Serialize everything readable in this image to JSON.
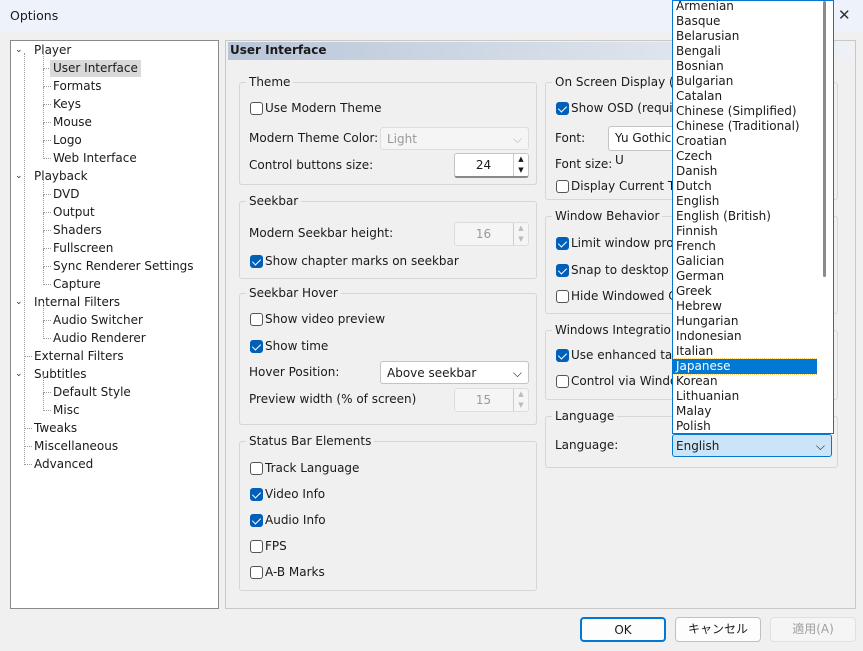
{
  "window": {
    "title": "Options"
  },
  "tree": [
    {
      "label": "Player",
      "level": 0,
      "expanded": true
    },
    {
      "label": "User Interface",
      "level": 1,
      "selected": true
    },
    {
      "label": "Formats",
      "level": 1
    },
    {
      "label": "Keys",
      "level": 1
    },
    {
      "label": "Mouse",
      "level": 1
    },
    {
      "label": "Logo",
      "level": 1
    },
    {
      "label": "Web Interface",
      "level": 1
    },
    {
      "label": "Playback",
      "level": 0,
      "expanded": true
    },
    {
      "label": "DVD",
      "level": 1
    },
    {
      "label": "Output",
      "level": 1
    },
    {
      "label": "Shaders",
      "level": 1
    },
    {
      "label": "Fullscreen",
      "level": 1
    },
    {
      "label": "Sync Renderer Settings",
      "level": 1
    },
    {
      "label": "Capture",
      "level": 1
    },
    {
      "label": "Internal Filters",
      "level": 0,
      "expanded": true
    },
    {
      "label": "Audio Switcher",
      "level": 1
    },
    {
      "label": "Audio Renderer",
      "level": 1
    },
    {
      "label": "External Filters",
      "level": 0
    },
    {
      "label": "Subtitles",
      "level": 0,
      "expanded": true
    },
    {
      "label": "Default Style",
      "level": 1
    },
    {
      "label": "Misc",
      "level": 1
    },
    {
      "label": "Tweaks",
      "level": 0
    },
    {
      "label": "Miscellaneous",
      "level": 0
    },
    {
      "label": "Advanced",
      "level": 0
    }
  ],
  "page_title": "User Interface",
  "theme": {
    "title": "Theme",
    "use_modern": "Use Modern Theme",
    "use_modern_checked": false,
    "color_label": "Modern Theme Color:",
    "color_value": "Light",
    "buttons_label": "Control buttons size:",
    "buttons_value": "24"
  },
  "seekbar": {
    "title": "Seekbar",
    "height_label": "Modern Seekbar height:",
    "height_value": "16",
    "chapter_marks": "Show chapter marks on seekbar",
    "chapter_marks_checked": true
  },
  "hover": {
    "title": "Seekbar Hover",
    "preview": "Show video preview",
    "preview_checked": false,
    "time": "Show time",
    "time_checked": true,
    "position_label": "Hover Position:",
    "position_value": "Above seekbar",
    "width_label": "Preview width (% of screen)",
    "width_value": "15"
  },
  "status": {
    "title": "Status Bar Elements",
    "items": [
      {
        "label": "Track Language",
        "checked": false
      },
      {
        "label": "Video Info",
        "checked": true
      },
      {
        "label": "Audio Info",
        "checked": true
      },
      {
        "label": "FPS",
        "checked": false
      },
      {
        "label": "A-B Marks",
        "checked": false
      }
    ]
  },
  "osd": {
    "title": "On Screen Display (OS",
    "show": "Show OSD (requires",
    "show_checked": true,
    "font_label": "Font:",
    "font_value": "Yu Gothic U",
    "size_label": "Font size:",
    "display_time": "Display Current Tim",
    "display_time_checked": false
  },
  "behavior": {
    "title": "Window Behavior",
    "items": [
      {
        "label": "Limit window prope",
        "checked": true
      },
      {
        "label": "Snap to desktop ed",
        "checked": true
      },
      {
        "label": "Hide Windowed Co",
        "checked": false
      }
    ]
  },
  "integration": {
    "title": "Windows Integration",
    "items": [
      {
        "label": "Use enhanced taskb",
        "checked": true
      },
      {
        "label": "Control via Window",
        "checked": false
      }
    ]
  },
  "language": {
    "title": "Language",
    "label": "Language:",
    "value": "English",
    "options": [
      "Armenian",
      "Basque",
      "Belarusian",
      "Bengali",
      "Bosnian",
      "Bulgarian",
      "Catalan",
      "Chinese (Simplified)",
      "Chinese (Traditional)",
      "Croatian",
      "Czech",
      "Danish",
      "Dutch",
      "English",
      "English (British)",
      "Finnish",
      "French",
      "Galician",
      "German",
      "Greek",
      "Hebrew",
      "Hungarian",
      "Indonesian",
      "Italian",
      "Japanese",
      "Korean",
      "Lithuanian",
      "Malay",
      "Polish"
    ],
    "highlighted": "Japanese"
  },
  "buttons": {
    "ok": "OK",
    "cancel": "キャンセル",
    "apply": "適用(A)"
  },
  "colors": {
    "accent": "#0078d4",
    "checkbox": "#005fb8"
  }
}
